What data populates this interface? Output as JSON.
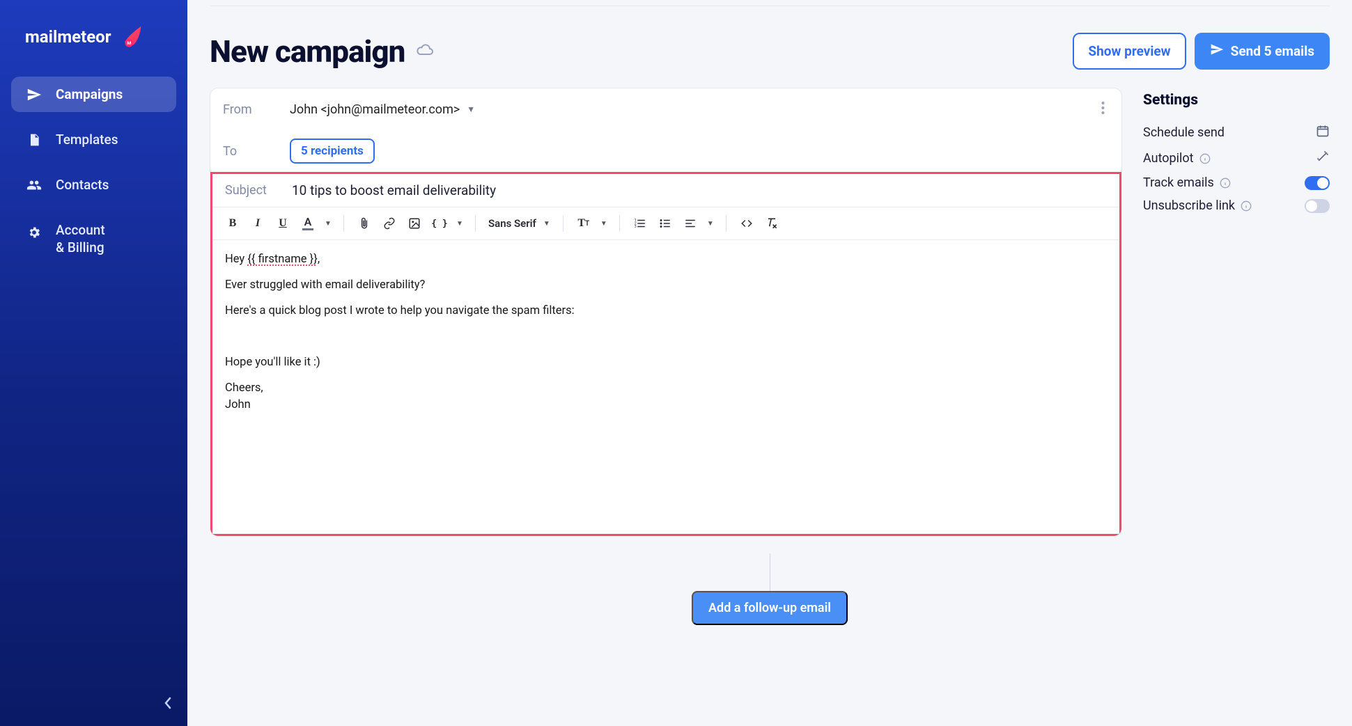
{
  "brand": {
    "name": "mailmeteor"
  },
  "sidebar": {
    "items": [
      {
        "label": "Campaigns"
      },
      {
        "label": "Templates"
      },
      {
        "label": "Contacts"
      },
      {
        "label": "Account\n& Billing"
      }
    ]
  },
  "header": {
    "title": "New campaign",
    "preview_label": "Show preview",
    "send_label": "Send 5 emails"
  },
  "composer": {
    "from_label": "From",
    "from_value": "John <john@mailmeteor.com>",
    "to_label": "To",
    "recipients_chip": "5 recipients",
    "subject_label": "Subject",
    "subject_value": "10 tips to boost email deliverability",
    "font_family": "Sans Serif",
    "body_lines": [
      "Hey {{ firstname }},",
      "Ever struggled with email deliverability?",
      "Here's a quick blog post I wrote to help you navigate the spam filters:",
      "",
      "Hope you'll like it :)",
      "Cheers,",
      "John"
    ]
  },
  "followup": {
    "button": "Add a follow-up email"
  },
  "settings": {
    "title": "Settings",
    "rows": [
      {
        "label": "Schedule send"
      },
      {
        "label": "Autopilot"
      },
      {
        "label": "Track emails"
      },
      {
        "label": "Unsubscribe link"
      }
    ]
  }
}
